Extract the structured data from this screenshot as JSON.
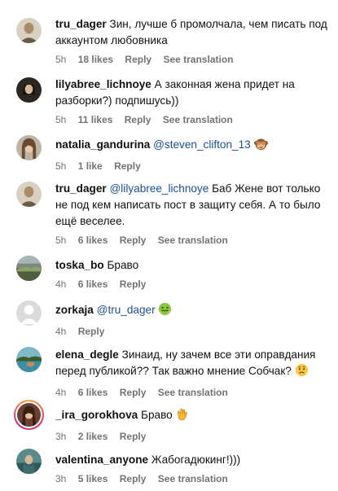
{
  "comments": [
    {
      "user": "tru_dager",
      "mention": "",
      "text": "Зин, лучше б промолчала, чем писать под аккаунтом любовника",
      "emoji": "",
      "time": "5h",
      "likes": "18 likes",
      "reply": "Reply",
      "translate": "See translation"
    },
    {
      "user": "lilyabree_lichnoye",
      "mention": "",
      "text": "А законная жена придет на разборки?) подпишусь))",
      "emoji": "",
      "time": "5h",
      "likes": "11 likes",
      "reply": "Reply",
      "translate": "See translation"
    },
    {
      "user": "natalia_gandurina",
      "mention": "@steven_clifton_13",
      "text": "",
      "emoji": "see-no-evil-monkey",
      "time": "5h",
      "likes": "1 like",
      "reply": "Reply",
      "translate": ""
    },
    {
      "user": "tru_dager",
      "mention": "@lilyabree_lichnoye",
      "text": "Баб Жене вот только не под кем написать пост в защиту себя. А то было ещё веселее.",
      "emoji": "",
      "time": "5h",
      "likes": "6 likes",
      "reply": "Reply",
      "translate": "See translation"
    },
    {
      "user": "toska_bo",
      "mention": "",
      "text": "Браво",
      "emoji": "",
      "time": "4h",
      "likes": "6 likes",
      "reply": "Reply",
      "translate": ""
    },
    {
      "user": "zorkaja",
      "mention": "@tru_dager",
      "text": "",
      "emoji": "nauseated-face",
      "time": "4h",
      "likes": "",
      "reply": "Reply",
      "translate": ""
    },
    {
      "user": "elena_degle",
      "mention": "",
      "text": "Зинаид, ну зачем все эти оправдания перед публикой?? Так важно мнение Собчак?",
      "emoji": "worried-face",
      "time": "4h",
      "likes": "6 likes",
      "reply": "Reply",
      "translate": "See translation"
    },
    {
      "user": "_ira_gorokhova",
      "mention": "",
      "text": "Браво",
      "emoji": "clapping-hands",
      "time": "3h",
      "likes": "2 likes",
      "reply": "Reply",
      "translate": ""
    },
    {
      "user": "valentina_anyone",
      "mention": "",
      "text": "Жабогадюкинг!)))",
      "emoji": "",
      "time": "3h",
      "likes": "5 likes",
      "reply": "Reply",
      "translate": "See translation"
    }
  ]
}
